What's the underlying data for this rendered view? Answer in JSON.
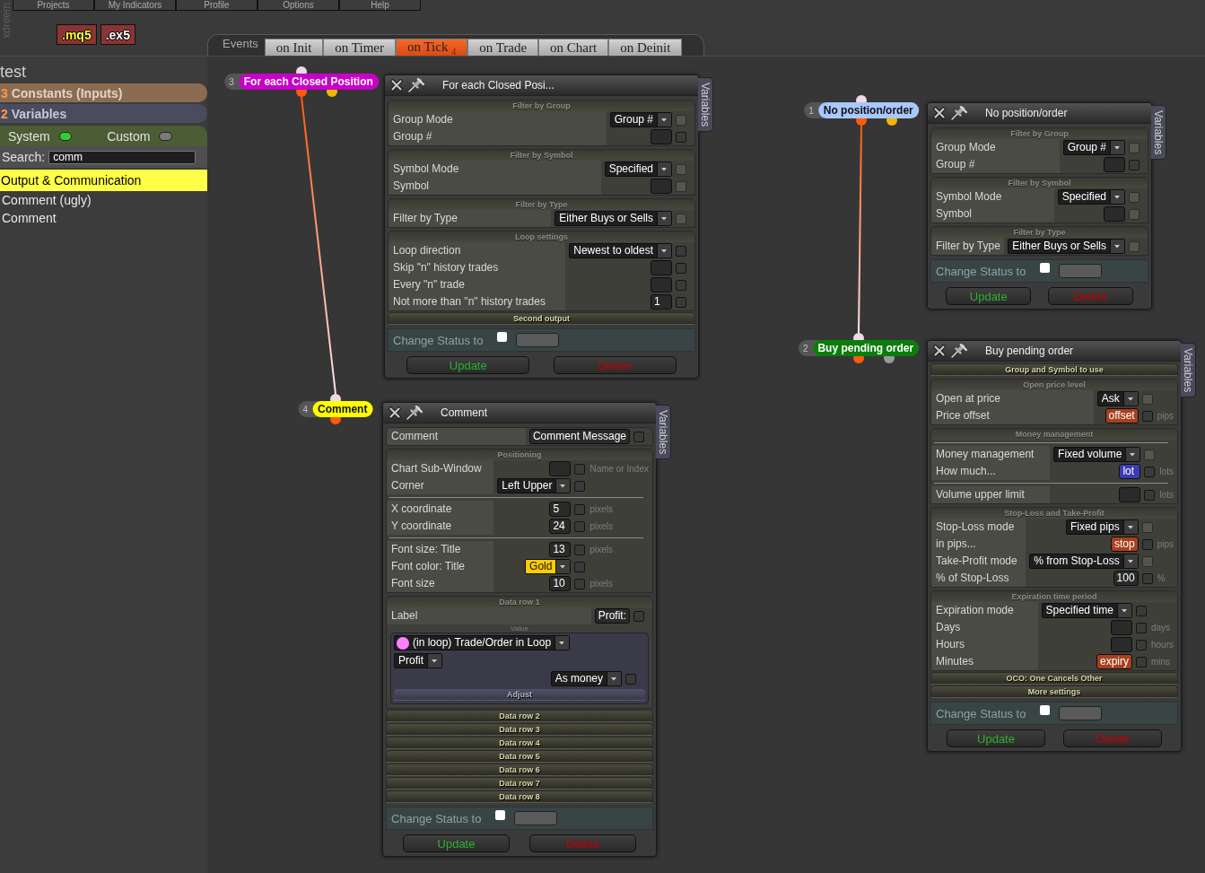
{
  "logo": "xdreem",
  "menu": [
    {
      "label": "Projects"
    },
    {
      "label": "My Indicators"
    },
    {
      "label": "Profile"
    },
    {
      "label": "Options"
    },
    {
      "label": "Help"
    }
  ],
  "file_buttons": [
    {
      "label": ".mq5",
      "kind": "source"
    },
    {
      "label": ".ex5",
      "kind": "compiled"
    }
  ],
  "events": {
    "label": "Events",
    "tabs": [
      {
        "label": "on Init",
        "selected": false
      },
      {
        "label": "on Timer",
        "selected": false
      },
      {
        "label": "on Tick",
        "count": "4",
        "selected": true
      },
      {
        "label": "on Trade",
        "selected": false
      },
      {
        "label": "on Chart",
        "selected": false
      },
      {
        "label": "on Deinit",
        "selected": false
      }
    ]
  },
  "sidebar": {
    "project": "test",
    "groups": [
      {
        "count": "3",
        "label": "Constants (Inputs)",
        "kind": "constants"
      },
      {
        "count": "2",
        "label": "Variables",
        "kind": "variables"
      }
    ],
    "toggles": [
      {
        "label": "System",
        "on": true
      },
      {
        "label": "Custom",
        "on": false
      }
    ],
    "search": {
      "label": "Search:",
      "value": "comm"
    },
    "categories": [
      {
        "label": "Output & Communication",
        "expanded": true,
        "children": [
          {
            "label": "Comment (ugly)",
            "selected": false
          },
          {
            "label": "Comment",
            "selected": false
          }
        ]
      }
    ]
  },
  "chains": [
    [
      {
        "number": "3",
        "label": "For each Closed Position",
        "color": "#c800c8",
        "outputs": [
          {
            "color": "#ff5a0a"
          },
          {
            "color": "#f2b600"
          }
        ]
      },
      {
        "number": "4",
        "label": "Comment",
        "color": "#ffff00",
        "outputs": [
          {
            "color": "#ff5a0a"
          }
        ]
      }
    ],
    [
      {
        "number": "1",
        "label": "No position/order",
        "color": "#a8c8ff",
        "outputs": [
          {
            "color": "#ff5a0a"
          },
          {
            "color": "#f2b600"
          }
        ]
      },
      {
        "number": "2",
        "label": "Buy pending order",
        "color": "#0a7d0a",
        "outputs": [
          {
            "color": "#ff5a0a"
          },
          {
            "color": "#9a9a9a"
          }
        ]
      }
    ]
  ],
  "panels": [
    {
      "title": "For each Closed Posi...",
      "side_tab": "Variables",
      "sections": [
        {
          "title": "Filter by Group",
          "expanded": true,
          "rows": [
            {
              "kind": "field",
              "label": "Group Mode",
              "control": {
                "kind": "select",
                "value": "Group #"
              },
              "checkbox": {
                "checked": false,
                "disabled": true
              }
            },
            {
              "kind": "field",
              "label": "Group #",
              "control": {
                "kind": "input"
              },
              "checkbox": {
                "checked": false,
                "disabled": false
              }
            }
          ]
        },
        {
          "title": "Filter by Symbol",
          "expanded": true,
          "rows": [
            {
              "kind": "field",
              "label": "Symbol Mode",
              "control": {
                "kind": "select",
                "value": "Specified"
              },
              "checkbox": {
                "checked": false,
                "disabled": true
              }
            },
            {
              "kind": "field",
              "label": "Symbol",
              "control": {
                "kind": "input"
              },
              "checkbox": {
                "checked": false,
                "disabled": true
              }
            }
          ]
        },
        {
          "title": "Filter by Type",
          "expanded": true,
          "rows": [
            {
              "kind": "field",
              "label": "Filter by Type",
              "control": {
                "kind": "select",
                "value": "Either Buys or Sells"
              },
              "checkbox": {
                "checked": false,
                "disabled": true
              }
            }
          ]
        },
        {
          "title": "Loop settings",
          "expanded": true,
          "rows": [
            {
              "kind": "field",
              "label": "Loop direction",
              "control": {
                "kind": "select",
                "value": "Newest to oldest"
              },
              "checkbox": {
                "checked": false,
                "disabled": false
              }
            },
            {
              "kind": "field",
              "label": "Skip \"n\" history trades",
              "control": {
                "kind": "input"
              },
              "checkbox": {
                "checked": false,
                "disabled": false
              }
            },
            {
              "kind": "field",
              "label": "Every \"n\" trade",
              "control": {
                "kind": "input"
              },
              "checkbox": {
                "checked": false,
                "disabled": false
              }
            },
            {
              "kind": "field",
              "label": "Not more than \"n\" history trades",
              "control": {
                "kind": "input",
                "value": "1"
              },
              "checkbox": {
                "checked": false,
                "disabled": false
              }
            }
          ]
        },
        {
          "title": "Second output",
          "expanded": false
        }
      ],
      "status": {
        "label": "Change Status to",
        "checked": false
      },
      "buttons": [
        {
          "label": "Update",
          "kind": "update"
        },
        {
          "label": "Delete",
          "kind": "delete"
        }
      ]
    },
    {
      "title": "Comment",
      "side_tab": "Variables",
      "sections": [
        {
          "rows": [
            {
              "kind": "field",
              "label": "Comment",
              "control": {
                "kind": "input",
                "value": "Comment Message"
              },
              "checkbox": {
                "checked": false,
                "disabled": false
              }
            }
          ]
        },
        {
          "title": "Positioning",
          "expanded": true,
          "rows": [
            {
              "kind": "field",
              "label": "Chart Sub-Window",
              "control": {
                "kind": "input"
              },
              "checkbox": {
                "checked": false,
                "disabled": false
              },
              "unit": "Name or Index"
            },
            {
              "kind": "field",
              "label": "Corner",
              "control": {
                "kind": "select",
                "value": "Left Upper"
              },
              "checkbox": {
                "checked": false,
                "disabled": false
              }
            },
            {
              "kind": "divider"
            },
            {
              "kind": "field",
              "label": "X coordinate",
              "control": {
                "kind": "input",
                "value": "5"
              },
              "checkbox": {
                "checked": false,
                "disabled": false
              },
              "unit": "pixels"
            },
            {
              "kind": "field",
              "label": "Y coordinate",
              "control": {
                "kind": "input",
                "value": "24"
              },
              "checkbox": {
                "checked": false,
                "disabled": false
              },
              "unit": "pixels"
            },
            {
              "kind": "divider"
            },
            {
              "kind": "field",
              "label": "Font size: Title",
              "control": {
                "kind": "input",
                "value": "13"
              },
              "checkbox": {
                "checked": false,
                "disabled": false
              },
              "unit": "pixels"
            },
            {
              "kind": "field",
              "label": "Font color: Title",
              "control": {
                "kind": "select",
                "value": "Gold",
                "color": "#ffcc00"
              },
              "checkbox": {
                "checked": false,
                "disabled": false
              }
            },
            {
              "kind": "field",
              "label": "Font size",
              "control": {
                "kind": "input",
                "value": "10"
              },
              "checkbox": {
                "checked": false,
                "disabled": false
              },
              "unit": "pixels"
            }
          ]
        },
        {
          "title": "Data row 1",
          "expanded": true,
          "rows": [
            {
              "kind": "field",
              "label": "Label",
              "control": {
                "kind": "input",
                "value": "Profit:"
              },
              "checkbox": {
                "checked": false,
                "disabled": false
              }
            },
            {
              "kind": "value",
              "label": "Value",
              "source": {
                "value": "(in loop) Trade/Order in Loop",
                "color": "#ff80ff"
              },
              "field": {
                "value": "Profit"
              },
              "format": {
                "value": "As money",
                "checkbox": {
                  "checked": false,
                  "disabled": false
                }
              },
              "adjust": {
                "title": "Adjust",
                "expanded": false
              }
            }
          ]
        },
        {
          "title": "Data row 2",
          "expanded": false
        },
        {
          "title": "Data row 3",
          "expanded": false
        },
        {
          "title": "Data row 4",
          "expanded": false
        },
        {
          "title": "Data row 5",
          "expanded": false
        },
        {
          "title": "Data row 6",
          "expanded": false
        },
        {
          "title": "Data row 7",
          "expanded": false
        },
        {
          "title": "Data row 8",
          "expanded": false
        }
      ],
      "status": {
        "label": "Change Status to",
        "checked": false
      },
      "buttons": [
        {
          "label": "Update",
          "kind": "update"
        },
        {
          "label": "Delete",
          "kind": "delete"
        }
      ]
    },
    {
      "title": "No position/order",
      "side_tab": "Variables",
      "sections": [
        {
          "title": "Filter by Group",
          "expanded": true,
          "rows": [
            {
              "kind": "field",
              "label": "Group Mode",
              "control": {
                "kind": "select",
                "value": "Group #"
              },
              "checkbox": {
                "checked": false,
                "disabled": true
              }
            },
            {
              "kind": "field",
              "label": "Group #",
              "control": {
                "kind": "input"
              },
              "checkbox": {
                "checked": false,
                "disabled": false
              }
            }
          ]
        },
        {
          "title": "Filter by Symbol",
          "expanded": true,
          "rows": [
            {
              "kind": "field",
              "label": "Symbol Mode",
              "control": {
                "kind": "select",
                "value": "Specified"
              },
              "checkbox": {
                "checked": false,
                "disabled": true
              }
            },
            {
              "kind": "field",
              "label": "Symbol",
              "control": {
                "kind": "input"
              },
              "checkbox": {
                "checked": false,
                "disabled": true
              }
            }
          ]
        },
        {
          "title": "Filter by Type",
          "expanded": true,
          "rows": [
            {
              "kind": "field",
              "label": "Filter by Type",
              "control": {
                "kind": "select",
                "value": "Either Buys or Sells"
              },
              "checkbox": {
                "checked": false,
                "disabled": true
              }
            }
          ]
        }
      ],
      "status": {
        "label": "Change Status to",
        "checked": false
      },
      "buttons": [
        {
          "label": "Update",
          "kind": "update"
        },
        {
          "label": "Delete",
          "kind": "delete"
        }
      ]
    },
    {
      "title": "Buy pending order",
      "side_tab": "Variables",
      "sections": [
        {
          "title": "Group and Symbol to use",
          "expanded": false
        },
        {
          "title": "Open price level",
          "expanded": true,
          "rows": [
            {
              "kind": "field",
              "label": "Open at price",
              "control": {
                "kind": "select",
                "value": "Ask"
              },
              "checkbox": {
                "checked": false,
                "disabled": true
              }
            },
            {
              "kind": "field",
              "label": "Price offset",
              "control": {
                "kind": "input",
                "value": "offset",
                "color": "#a8401e"
              },
              "checkbox": {
                "checked": false,
                "disabled": false
              },
              "unit": "pips"
            }
          ]
        },
        {
          "title": "Money management",
          "expanded": true,
          "rows": [
            {
              "kind": "divider"
            },
            {
              "kind": "field",
              "label": "Money management",
              "control": {
                "kind": "select",
                "value": "Fixed volume"
              },
              "checkbox": {
                "checked": false,
                "disabled": true
              }
            },
            {
              "kind": "field",
              "label": "How much...",
              "control": {
                "kind": "input",
                "value": "lot",
                "color": "#3c3cb0"
              },
              "checkbox": {
                "checked": false,
                "disabled": false
              },
              "unit": "lots"
            },
            {
              "kind": "divider"
            },
            {
              "kind": "field",
              "label": "Volume upper limit",
              "control": {
                "kind": "input"
              },
              "checkbox": {
                "checked": false,
                "disabled": false
              },
              "unit": "lots"
            }
          ]
        },
        {
          "title": "Stop-Loss and Take-Profit",
          "expanded": true,
          "rows": [
            {
              "kind": "field",
              "label": "Stop-Loss mode",
              "control": {
                "kind": "select",
                "value": "Fixed pips"
              },
              "checkbox": {
                "checked": false,
                "disabled": true
              }
            },
            {
              "kind": "field",
              "label": "in pips...",
              "control": {
                "kind": "input",
                "value": "stop",
                "color": "#a8401e"
              },
              "checkbox": {
                "checked": false,
                "disabled": false
              },
              "unit": "pips"
            },
            {
              "kind": "field",
              "label": "Take-Profit mode",
              "control": {
                "kind": "select",
                "value": "% from Stop-Loss"
              },
              "checkbox": {
                "checked": false,
                "disabled": true
              }
            },
            {
              "kind": "field",
              "label": "% of Stop-Loss",
              "control": {
                "kind": "input",
                "value": "100"
              },
              "checkbox": {
                "checked": false,
                "disabled": false
              },
              "unit": "%"
            }
          ]
        },
        {
          "title": "Expiration time period",
          "expanded": true,
          "rows": [
            {
              "kind": "field",
              "label": "Expiration mode",
              "control": {
                "kind": "select",
                "value": "Specified time"
              },
              "checkbox": {
                "checked": false,
                "disabled": false
              }
            },
            {
              "kind": "field",
              "label": "Days",
              "control": {
                "kind": "input"
              },
              "checkbox": {
                "checked": false,
                "disabled": false
              },
              "unit": "days"
            },
            {
              "kind": "field",
              "label": "Hours",
              "control": {
                "kind": "input"
              },
              "checkbox": {
                "checked": false,
                "disabled": false
              },
              "unit": "hours"
            },
            {
              "kind": "field",
              "label": "Minutes",
              "control": {
                "kind": "input",
                "value": "expiry",
                "color": "#a8401e"
              },
              "checkbox": {
                "checked": false,
                "disabled": false
              },
              "unit": "mins"
            }
          ]
        },
        {
          "title": "OCO: One Cancels Other",
          "expanded": false
        },
        {
          "title": "More settings",
          "expanded": false
        }
      ],
      "status": {
        "label": "Change Status to",
        "checked": false
      },
      "buttons": [
        {
          "label": "Update",
          "kind": "update"
        },
        {
          "label": "Delete",
          "kind": "delete"
        }
      ]
    }
  ]
}
